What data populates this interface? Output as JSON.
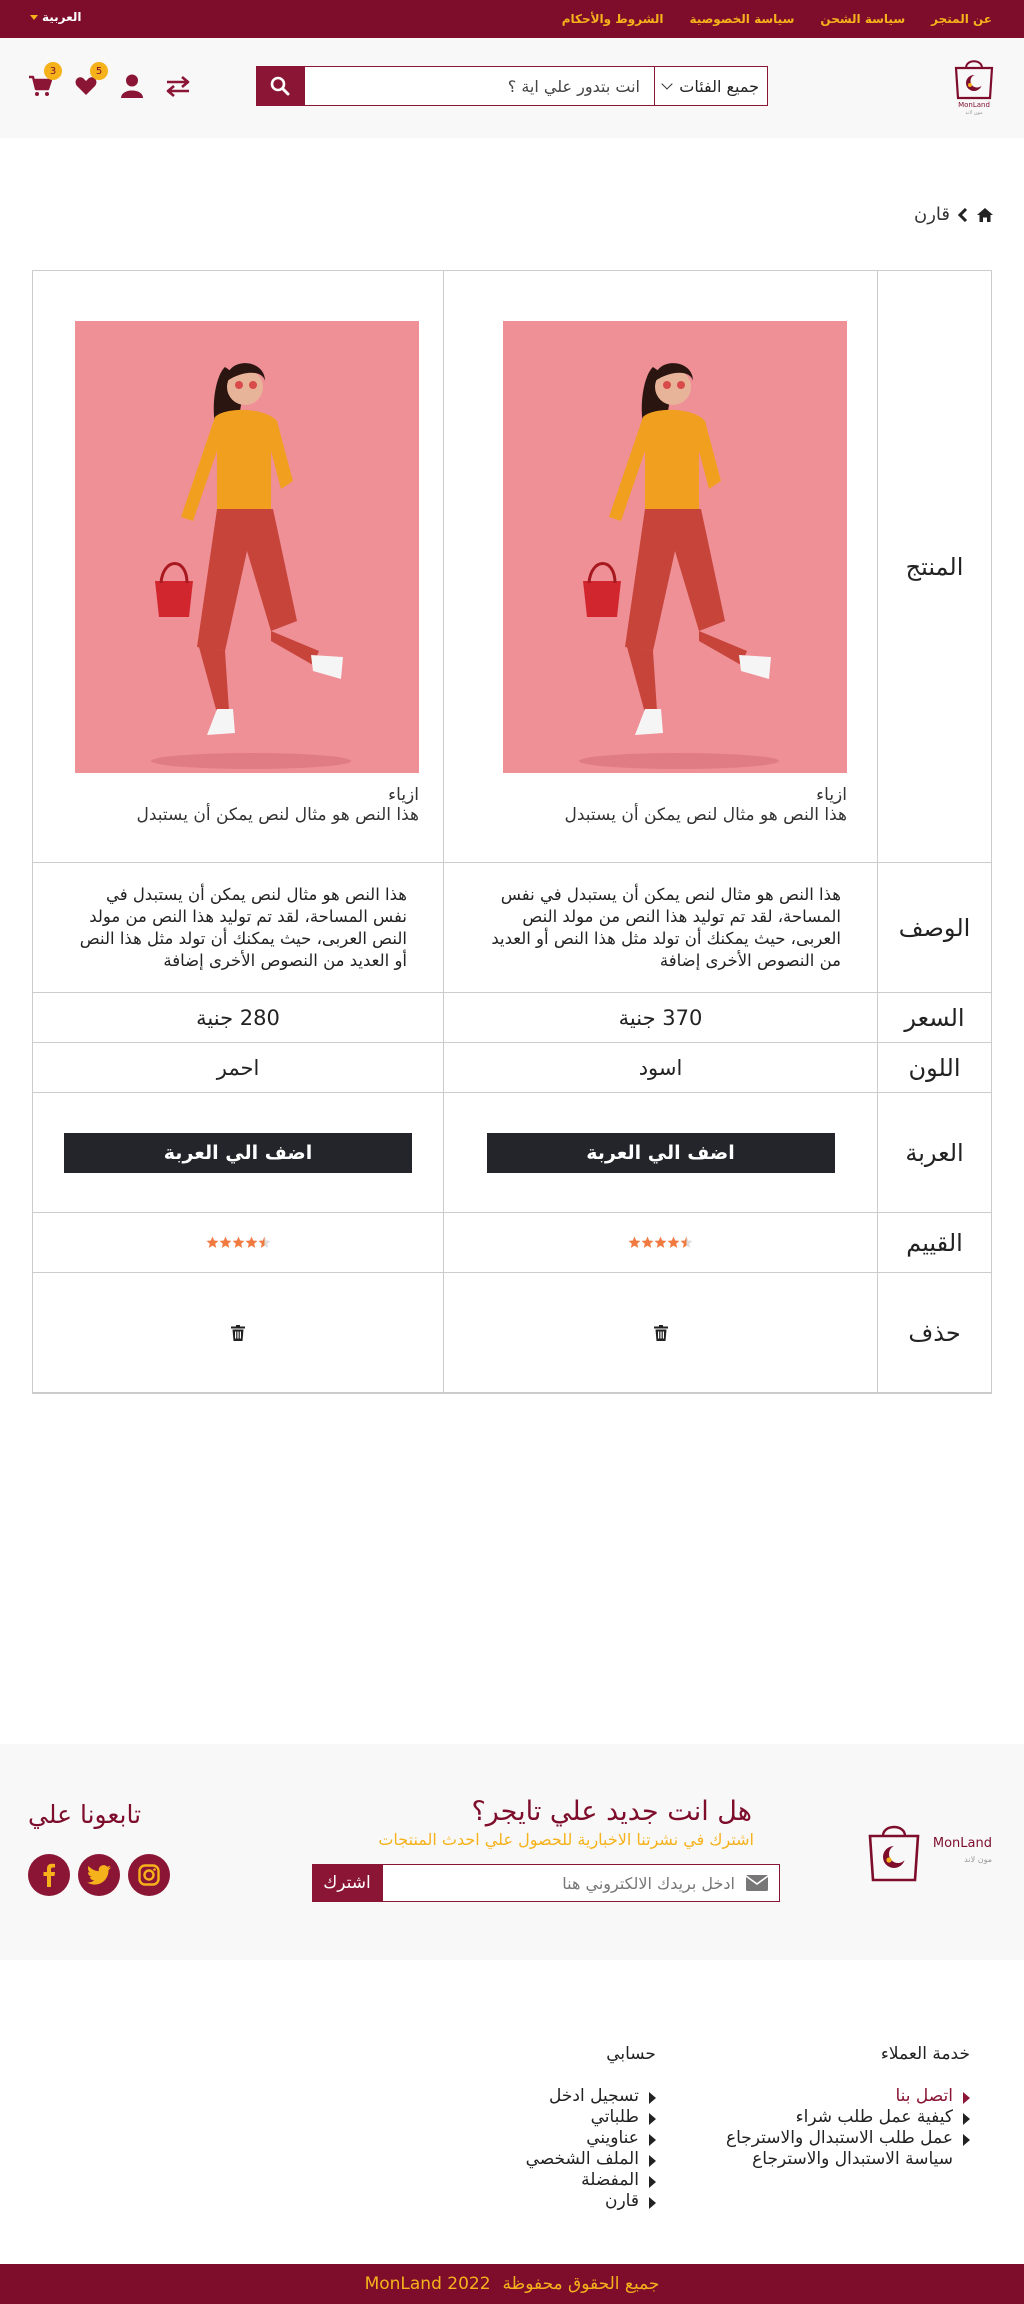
{
  "topbar": {
    "links": [
      "عن المتجر",
      "سياسة الشحن",
      "سياسة الخصوصية",
      "الشروط والأحكام"
    ],
    "language": "العربية"
  },
  "header": {
    "logo_text": "MonLand",
    "logo_sub": "مون لاند",
    "search": {
      "category_label": "جميع الفئات",
      "placeholder": "انت بتدور علي اية ؟"
    },
    "wishlist_count": "5",
    "cart_count": "3"
  },
  "breadcrumb": {
    "current": "قارن"
  },
  "compare": {
    "row_labels": {
      "product": "المنتج",
      "description": "الوصف",
      "price": "السعر",
      "color": "اللون",
      "cart": "العربة",
      "rating": "القييم",
      "delete": "حذف"
    },
    "products": [
      {
        "category": "ازياء",
        "name": "هذا النص هو مثال لنص يمكن أن يستبدل",
        "description": "هذا النص هو مثال لنص يمكن أن يستبدل في نفس المساحة، لقد تم توليد هذا النص من مولد النص العربى، حيث يمكنك أن تولد مثل هذا النص أو العديد من النصوص الأخرى إضافة",
        "price": "370 جنية",
        "color": "اسود",
        "add_to_cart": "اضف الي العربة",
        "rating": 4.5
      },
      {
        "category": "ازياء",
        "name": "هذا النص هو مثال لنص يمكن أن يستبدل",
        "description": "هذا النص هو مثال لنص يمكن أن يستبدل في نفس المساحة، لقد تم توليد هذا النص من مولد النص العربى، حيث يمكنك أن تولد مثل هذا النص أو العديد من النصوص الأخرى إضافة",
        "price": "280 جنية",
        "color": "احمر",
        "add_to_cart": "اضف الي العربة",
        "rating": 4.5
      }
    ]
  },
  "newsletter": {
    "logo_text": "MonLand",
    "logo_sub": "مون لاند",
    "title": "هل انت جديد علي تايجر؟",
    "subtitle": "اشترك في نشرتنا الاخبارية للحصول علي احدث المنتجات",
    "placeholder": "ادخل بريدك الالكتروني هنا",
    "subscribe": "اشترك",
    "follow": "تابعونا علي"
  },
  "footer": {
    "customer_service": {
      "title": "خدمة العملاء",
      "items": [
        "اتصل بنا",
        "كيفية عمل طلب شراء",
        "عمل طلب الاستبدال والاسترجاع",
        "سياسة الاستبدال والاسترجاع"
      ]
    },
    "account": {
      "title": "حسابي",
      "items": [
        "تسجيل  ادخل",
        "طلباتي",
        "عناويني",
        "الملف الشخصي",
        "المفضلة",
        "قارن"
      ]
    },
    "copyright_text": "جميع الحقوق محفوظة",
    "copyright_brand": "MonLand 2022"
  },
  "colors": {
    "brand": "#7e0d2c",
    "accent": "#f5b21b",
    "dark_button": "#23252b",
    "star": "#f07a3f"
  }
}
